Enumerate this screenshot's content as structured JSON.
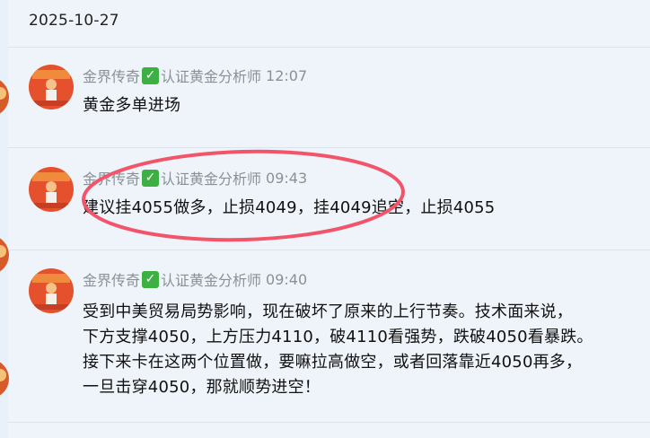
{
  "date": "2025-10-27",
  "messages": [
    {
      "name": "金界传奇",
      "verified": "认证黄金分析师",
      "time": "12:07",
      "lines": [
        "黄金多单进场"
      ]
    },
    {
      "name": "金界传奇",
      "verified": "认证黄金分析师",
      "time": "09:43",
      "lines": [
        "建议挂4055做多，止损4049，挂4049追空，止损4055"
      ]
    },
    {
      "name": "金界传奇",
      "verified": "认证黄金分析师",
      "time": "09:40",
      "lines": [
        "受到中美贸易局势影响，现在破坏了原来的上行节奏。技术面来说，",
        "下方支撑4050，上方压力4110，破4110看强势，跌破4050看暴跌。",
        "接下来卡在这两个位置做，要嘛拉高做空，或者回落靠近4050再多，",
        "一旦击穿4050，那就顺势进空！"
      ]
    }
  ],
  "icons": {
    "check": "check-mark-icon",
    "avatar": "avatar"
  },
  "colors": {
    "background": "#eef4fa",
    "verified_check": "#3cb043",
    "annotation_oval": "#f2556a"
  }
}
